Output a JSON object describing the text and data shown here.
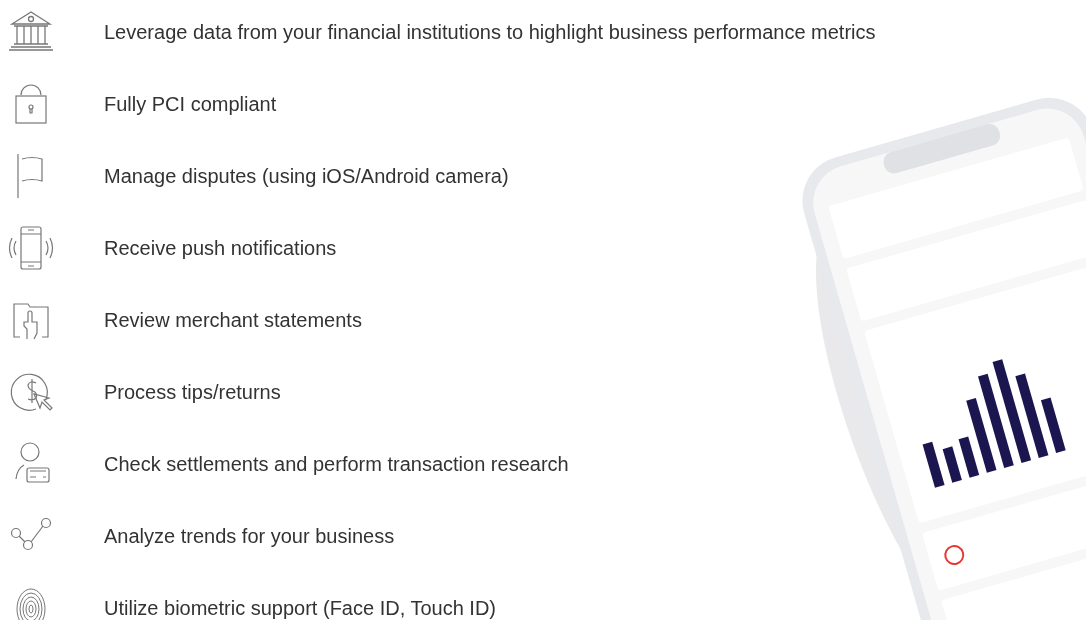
{
  "features": [
    {
      "text": "Leverage data from your financial institutions to highlight business performance metrics"
    },
    {
      "text": "Fully PCI compliant"
    },
    {
      "text": "Manage disputes (using iOS/Android camera)"
    },
    {
      "text": "Receive push notifications"
    },
    {
      "text": "Review merchant statements"
    },
    {
      "text": "Process tips/returns"
    },
    {
      "text": "Check settlements and perform transaction research"
    },
    {
      "text": "Analyze trends for your business"
    },
    {
      "text": "Utilize biometric support (Face ID, Touch ID)"
    }
  ]
}
